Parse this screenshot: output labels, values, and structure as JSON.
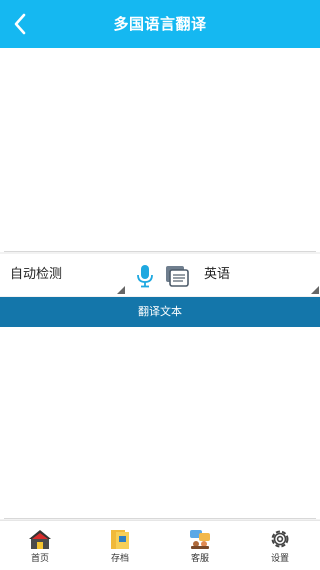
{
  "header": {
    "title": "多国语言翻译",
    "back_icon": "chevron-left-icon"
  },
  "input": {
    "text": ""
  },
  "languages": {
    "source": "自动检测",
    "target": "英语"
  },
  "tools": {
    "mic_icon": "microphone-icon",
    "doc_icon": "document-icon"
  },
  "action": {
    "translate_label": "翻译文本"
  },
  "output": {
    "text": ""
  },
  "tabs": [
    {
      "label": "首页",
      "icon": "home-icon"
    },
    {
      "label": "存档",
      "icon": "archive-icon"
    },
    {
      "label": "客服",
      "icon": "customer-service-icon"
    },
    {
      "label": "设置",
      "icon": "settings-gear-icon"
    }
  ],
  "colors": {
    "header": "#15b8f1",
    "button": "#1476aa",
    "mic": "#1ea8e0"
  }
}
